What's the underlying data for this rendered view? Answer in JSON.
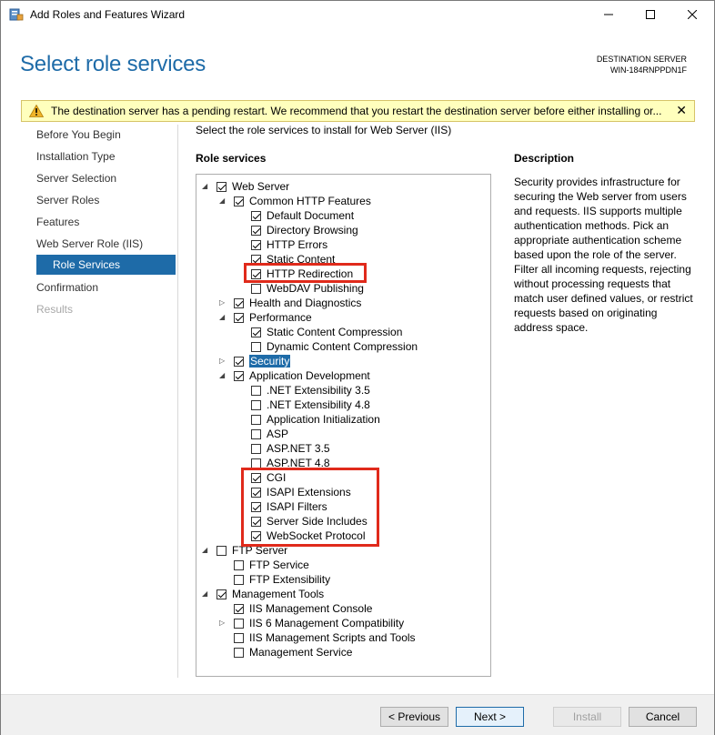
{
  "window": {
    "title": "Add Roles and Features Wizard"
  },
  "header": {
    "title": "Select role services",
    "destination_label": "DESTINATION SERVER",
    "destination_value": "WIN-184RNPPDN1F"
  },
  "warning": {
    "text": "The destination server has a pending restart. We recommend that you restart the destination server before either installing or..."
  },
  "nav": {
    "items": [
      {
        "label": "Before You Begin"
      },
      {
        "label": "Installation Type"
      },
      {
        "label": "Server Selection"
      },
      {
        "label": "Server Roles"
      },
      {
        "label": "Features"
      },
      {
        "label": "Web Server Role (IIS)"
      },
      {
        "label": "Role Services"
      },
      {
        "label": "Confirmation"
      },
      {
        "label": "Results"
      }
    ]
  },
  "main": {
    "instruction": "Select the role services to install for Web Server (IIS)",
    "role_services_heading": "Role services",
    "description_heading": "Description",
    "description_text": "Security provides infrastructure for securing the Web server from users and requests. IIS supports multiple authentication methods. Pick an appropriate authentication scheme based upon the role of the server. Filter all incoming requests, rejecting without processing requests that match user defined values, or restrict requests based on originating address space."
  },
  "tree": [
    {
      "label": "Web Server",
      "level": 0,
      "checked": true,
      "expander": "open"
    },
    {
      "label": "Common HTTP Features",
      "level": 1,
      "checked": true,
      "expander": "open"
    },
    {
      "label": "Default Document",
      "level": 2,
      "checked": true,
      "expander": ""
    },
    {
      "label": "Directory Browsing",
      "level": 2,
      "checked": true,
      "expander": ""
    },
    {
      "label": "HTTP Errors",
      "level": 2,
      "checked": true,
      "expander": ""
    },
    {
      "label": "Static Content",
      "level": 2,
      "checked": true,
      "expander": ""
    },
    {
      "label": "HTTP Redirection",
      "level": 2,
      "checked": true,
      "expander": ""
    },
    {
      "label": "WebDAV Publishing",
      "level": 2,
      "checked": false,
      "expander": ""
    },
    {
      "label": "Health and Diagnostics",
      "level": 1,
      "checked": true,
      "expander": "closed"
    },
    {
      "label": "Performance",
      "level": 1,
      "checked": true,
      "expander": "open"
    },
    {
      "label": "Static Content Compression",
      "level": 2,
      "checked": true,
      "expander": ""
    },
    {
      "label": "Dynamic Content Compression",
      "level": 2,
      "checked": false,
      "expander": ""
    },
    {
      "label": "Security",
      "level": 1,
      "checked": true,
      "expander": "closed",
      "selected": true
    },
    {
      "label": "Application Development",
      "level": 1,
      "checked": true,
      "expander": "open"
    },
    {
      "label": ".NET Extensibility 3.5",
      "level": 2,
      "checked": false,
      "expander": ""
    },
    {
      "label": ".NET Extensibility 4.8",
      "level": 2,
      "checked": false,
      "expander": ""
    },
    {
      "label": "Application Initialization",
      "level": 2,
      "checked": false,
      "expander": ""
    },
    {
      "label": "ASP",
      "level": 2,
      "checked": false,
      "expander": ""
    },
    {
      "label": "ASP.NET 3.5",
      "level": 2,
      "checked": false,
      "expander": ""
    },
    {
      "label": "ASP.NET 4.8",
      "level": 2,
      "checked": false,
      "expander": ""
    },
    {
      "label": "CGI",
      "level": 2,
      "checked": true,
      "expander": ""
    },
    {
      "label": "ISAPI Extensions",
      "level": 2,
      "checked": true,
      "expander": ""
    },
    {
      "label": "ISAPI Filters",
      "level": 2,
      "checked": true,
      "expander": ""
    },
    {
      "label": "Server Side Includes",
      "level": 2,
      "checked": true,
      "expander": ""
    },
    {
      "label": "WebSocket Protocol",
      "level": 2,
      "checked": true,
      "expander": ""
    },
    {
      "label": "FTP Server",
      "level": 0,
      "checked": false,
      "expander": "open"
    },
    {
      "label": "FTP Service",
      "level": 1,
      "checked": false,
      "expander": ""
    },
    {
      "label": "FTP Extensibility",
      "level": 1,
      "checked": false,
      "expander": ""
    },
    {
      "label": "Management Tools",
      "level": 0,
      "checked": true,
      "expander": "open"
    },
    {
      "label": "IIS Management Console",
      "level": 1,
      "checked": true,
      "expander": ""
    },
    {
      "label": "IIS 6 Management Compatibility",
      "level": 1,
      "checked": false,
      "expander": "closed"
    },
    {
      "label": "IIS Management Scripts and Tools",
      "level": 1,
      "checked": false,
      "expander": ""
    },
    {
      "label": "Management Service",
      "level": 1,
      "checked": false,
      "expander": ""
    }
  ],
  "buttons": {
    "previous": "< Previous",
    "next": "Next >",
    "install": "Install",
    "cancel": "Cancel"
  },
  "colors": {
    "accent": "#1e6ba8",
    "warning_bg": "#ffffbd",
    "highlight": "#e02a1b"
  }
}
